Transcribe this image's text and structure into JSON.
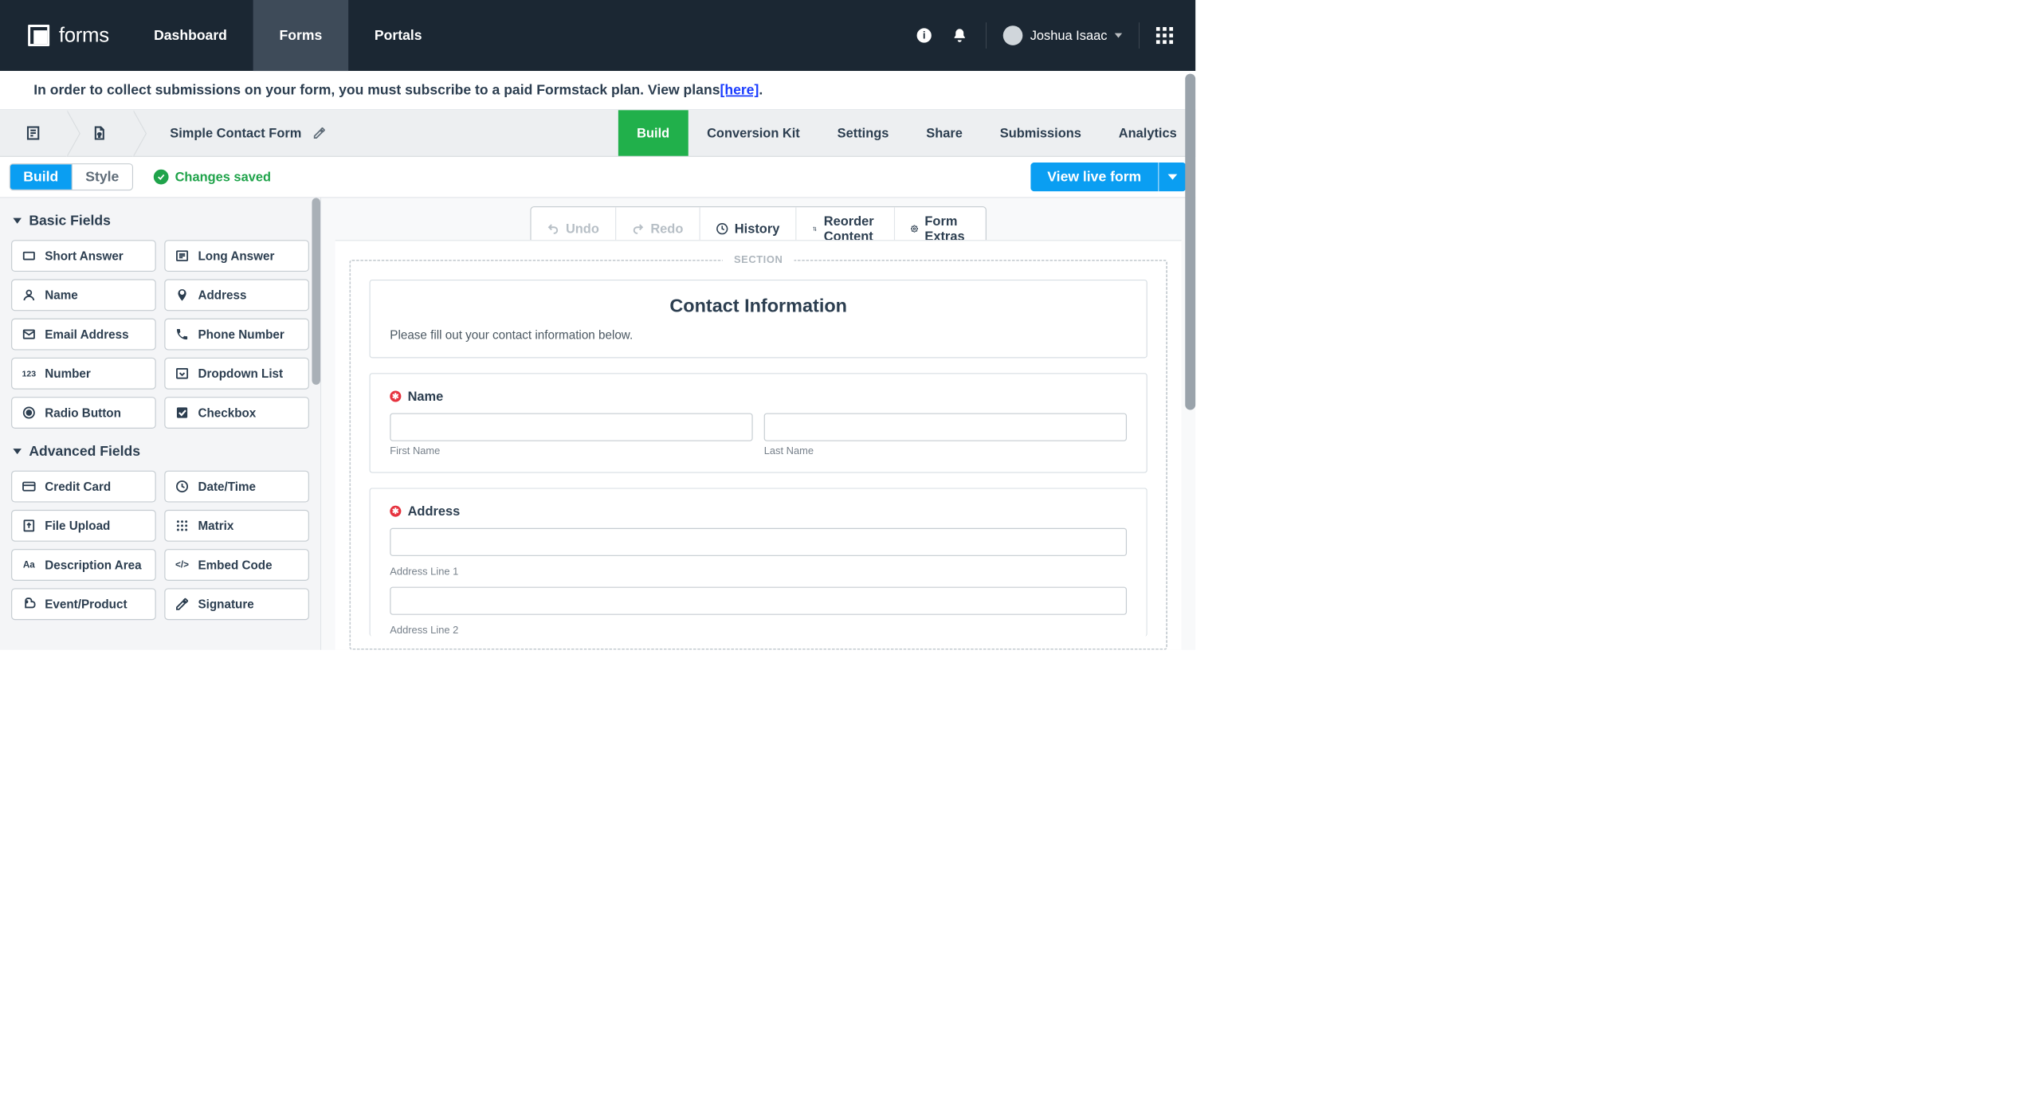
{
  "app": {
    "name": "forms"
  },
  "top_tabs": [
    "Dashboard",
    "Forms",
    "Portals"
  ],
  "top_tabs_active": 1,
  "user": {
    "name": "Joshua Isaac"
  },
  "banner": {
    "text_before": "In order to collect submissions on your form, you must subscribe to a paid Formstack plan. View plans ",
    "link_label": "[here]",
    "text_after": "."
  },
  "form": {
    "title": "Simple Contact Form"
  },
  "builder_tabs": [
    "Build",
    "Conversion Kit",
    "Settings",
    "Share",
    "Submissions",
    "Analytics"
  ],
  "builder_tabs_active": 0,
  "mode_seg": {
    "build": "Build",
    "style": "Style"
  },
  "save_status": "Changes saved",
  "live_button": "View live form",
  "sidebar": {
    "groups": [
      {
        "title": "Basic Fields",
        "items": [
          {
            "icon": "short-answer",
            "label": "Short Answer"
          },
          {
            "icon": "long-answer",
            "label": "Long Answer"
          },
          {
            "icon": "name",
            "label": "Name"
          },
          {
            "icon": "address",
            "label": "Address"
          },
          {
            "icon": "email",
            "label": "Email Address"
          },
          {
            "icon": "phone",
            "label": "Phone Number"
          },
          {
            "icon": "number",
            "label": "Number"
          },
          {
            "icon": "dropdown",
            "label": "Dropdown List"
          },
          {
            "icon": "radio",
            "label": "Radio Button"
          },
          {
            "icon": "checkbox",
            "label": "Checkbox"
          }
        ]
      },
      {
        "title": "Advanced Fields",
        "items": [
          {
            "icon": "credit-card",
            "label": "Credit Card"
          },
          {
            "icon": "datetime",
            "label": "Date/Time"
          },
          {
            "icon": "upload",
            "label": "File Upload"
          },
          {
            "icon": "matrix",
            "label": "Matrix"
          },
          {
            "icon": "description",
            "label": "Description Area"
          },
          {
            "icon": "embed",
            "label": "Embed Code"
          },
          {
            "icon": "event",
            "label": "Event/Product"
          },
          {
            "icon": "signature",
            "label": "Signature"
          }
        ]
      }
    ]
  },
  "canvas_toolbar": {
    "undo": "Undo",
    "redo": "Redo",
    "history": "History",
    "reorder": "Reorder Content",
    "extras": "Form Extras"
  },
  "section_label": "SECTION",
  "section": {
    "title": "Contact Information",
    "description": "Please fill out your contact information below."
  },
  "form_fields": {
    "name": {
      "label": "Name",
      "sublabels": [
        "First Name",
        "Last Name"
      ]
    },
    "address": {
      "label": "Address",
      "sublabels": [
        "Address Line 1",
        "Address Line 2"
      ]
    }
  }
}
